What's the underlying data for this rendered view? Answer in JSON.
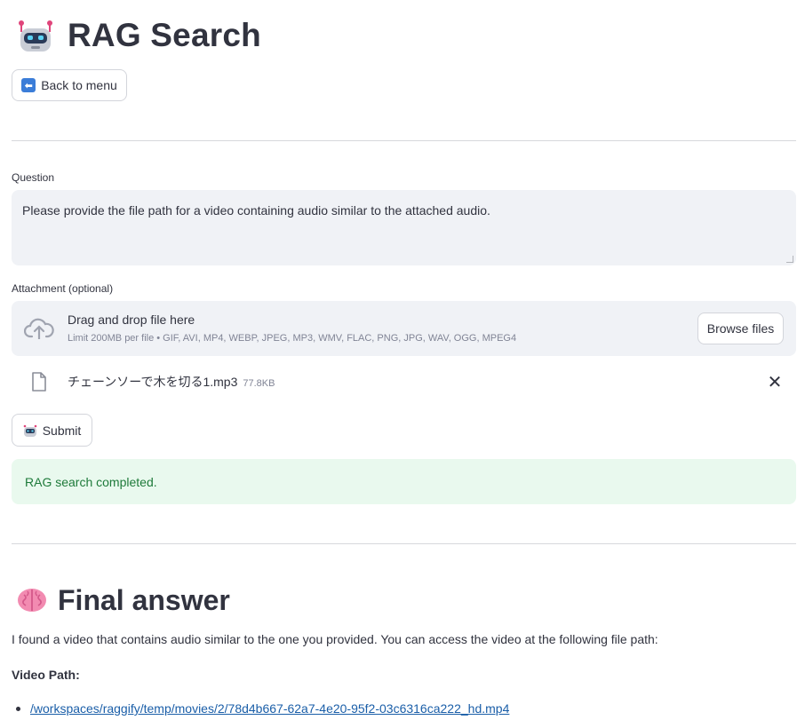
{
  "header": {
    "title": "RAG Search",
    "icon": "robot-icon"
  },
  "back_button": {
    "label": "Back to menu",
    "icon": "back-arrow-icon"
  },
  "question": {
    "label": "Question",
    "value": "Please provide the file path for a video containing audio similar to the attached audio."
  },
  "attachment": {
    "label": "Attachment (optional)",
    "dropzone_title": "Drag and drop file here",
    "dropzone_limits": "Limit 200MB per file • GIF, AVI, MP4, WEBP, JPEG, MP3, WMV, FLAC, PNG, JPG, WAV, OGG, MPEG4",
    "browse_label": "Browse files",
    "file": {
      "name": "チェーンソーで木を切る1.mp3",
      "size": "77.8KB"
    }
  },
  "submit_button": {
    "label": "Submit"
  },
  "status": {
    "message": "RAG search completed.",
    "color": "#1e7a3a",
    "background": "#e9f9ee"
  },
  "answer": {
    "title": "Final answer",
    "icon": "brain-icon",
    "text": "I found a video that contains audio similar to the one you provided. You can access the video at the following file path:",
    "video_label": "Video Path:",
    "video_path": "/workspaces/raggify/temp/movies/2/78d4b667-62a7-4e20-95f2-03c6316ca222_hd.mp4"
  },
  "colors": {
    "accent_link": "#1a5ea8",
    "input_bg": "#f0f2f6",
    "text": "#31333f"
  }
}
